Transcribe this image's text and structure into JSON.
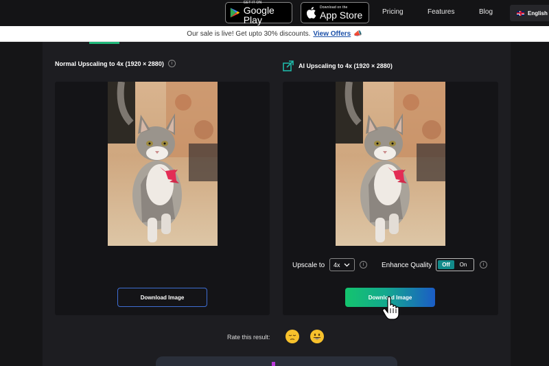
{
  "header": {
    "google_play": {
      "small": "GET IT ON",
      "big": "Google Play"
    },
    "app_store": {
      "small": "Download on the",
      "big": "App Store"
    },
    "nav": [
      "Pricing",
      "Features",
      "Blog"
    ],
    "language": "English"
  },
  "banner": {
    "text": "Our sale is live! Get upto 30% discounts.",
    "link": "View Offers"
  },
  "left_panel": {
    "title": "Normal Upscaling to 4x (1920 × 2880)",
    "download_label": "Download Image"
  },
  "right_panel": {
    "title": "AI Upscaling to 4x (1920 × 2880)",
    "upscale_label": "Upscale to",
    "upscale_value": "4x",
    "enhance_label": "Enhance Quality",
    "toggle_off": "Off",
    "toggle_on": "On",
    "toggle_state": "Off",
    "download_label": "Download Image"
  },
  "rating": {
    "label": "Rate this result:",
    "options": [
      "sad-face-icon",
      "smiling-face-icon"
    ]
  },
  "colors": {
    "accent_green": "#14c46e",
    "accent_blue": "#1b5cc6",
    "link_blue": "#1a4fa8",
    "toggle_teal": "#128a8a"
  }
}
